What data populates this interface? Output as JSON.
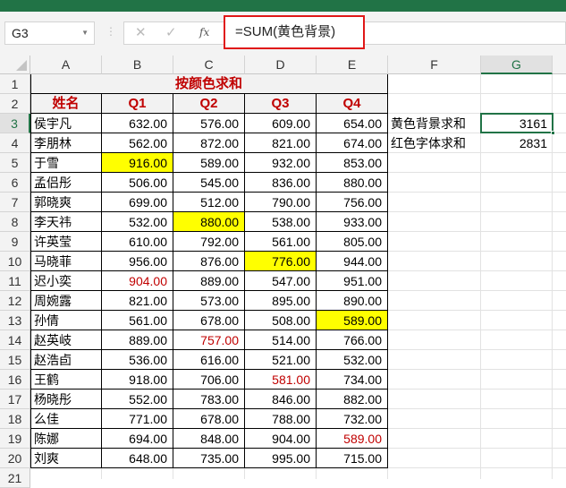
{
  "name_box": "G3",
  "formula": "=SUM(黄色背景)",
  "columns": [
    "A",
    "B",
    "C",
    "D",
    "E",
    "F",
    "G"
  ],
  "rows": [
    "1",
    "2",
    "3",
    "4",
    "5",
    "6",
    "7",
    "8",
    "9",
    "10",
    "11",
    "12",
    "13",
    "14",
    "15",
    "16",
    "17",
    "18",
    "19",
    "20",
    "21"
  ],
  "title": "按颜色求和",
  "headers": [
    "姓名",
    "Q1",
    "Q2",
    "Q3",
    "Q4"
  ],
  "data": [
    [
      "侯宇凡",
      "632.00",
      "576.00",
      "609.00",
      "654.00"
    ],
    [
      "李朋林",
      "562.00",
      "872.00",
      "821.00",
      "674.00"
    ],
    [
      "于雪",
      "916.00",
      "589.00",
      "932.00",
      "853.00"
    ],
    [
      "孟侣彤",
      "506.00",
      "545.00",
      "836.00",
      "880.00"
    ],
    [
      "郭晓爽",
      "699.00",
      "512.00",
      "790.00",
      "756.00"
    ],
    [
      "李天祎",
      "532.00",
      "880.00",
      "538.00",
      "933.00"
    ],
    [
      "许英莹",
      "610.00",
      "792.00",
      "561.00",
      "805.00"
    ],
    [
      "马晓菲",
      "956.00",
      "876.00",
      "776.00",
      "944.00"
    ],
    [
      "迟小奕",
      "904.00",
      "889.00",
      "547.00",
      "951.00"
    ],
    [
      "周婉露",
      "821.00",
      "573.00",
      "895.00",
      "890.00"
    ],
    [
      "孙倩",
      "561.00",
      "678.00",
      "508.00",
      "589.00"
    ],
    [
      "赵英岐",
      "889.00",
      "757.00",
      "514.00",
      "766.00"
    ],
    [
      "赵浩卣",
      "536.00",
      "616.00",
      "521.00",
      "532.00"
    ],
    [
      "王鹤",
      "918.00",
      "706.00",
      "581.00",
      "734.00"
    ],
    [
      "杨晓彤",
      "552.00",
      "783.00",
      "846.00",
      "882.00"
    ],
    [
      "么佳",
      "771.00",
      "678.00",
      "788.00",
      "732.00"
    ],
    [
      "陈娜",
      "694.00",
      "848.00",
      "904.00",
      "589.00"
    ],
    [
      "刘爽",
      "648.00",
      "735.00",
      "995.00",
      "715.00"
    ]
  ],
  "yellow_cells": [
    [
      2,
      1
    ],
    [
      5,
      2
    ],
    [
      7,
      3
    ],
    [
      10,
      4
    ]
  ],
  "red_text_cells": [
    [
      8,
      1
    ],
    [
      11,
      2
    ],
    [
      13,
      3
    ],
    [
      16,
      4
    ]
  ],
  "summary": [
    {
      "label": "黄色背景求和",
      "value": "3161"
    },
    {
      "label": "红色字体求和",
      "value": "2831"
    }
  ],
  "colors": {
    "accent": "#217346",
    "header_red": "#c00000",
    "highlight": "#ffff00",
    "formula_box": "#e01818"
  }
}
